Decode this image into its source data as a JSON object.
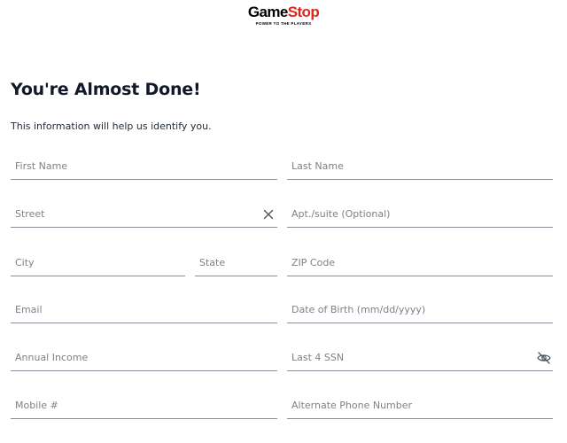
{
  "logo": {
    "brand_part1": "Game",
    "brand_part2": "Stop",
    "tagline": "POWER TO THE PLAYERS",
    "brand_color": "#e1251b"
  },
  "heading": "You're Almost Done!",
  "subtitle": "This information will help us identify you.",
  "fields": {
    "first_name": {
      "placeholder": "First Name",
      "value": ""
    },
    "last_name": {
      "placeholder": "Last Name",
      "value": ""
    },
    "street": {
      "placeholder": "Street",
      "value": "",
      "icon": "close-icon"
    },
    "apt": {
      "placeholder": "Apt./suite (Optional)",
      "value": ""
    },
    "city": {
      "placeholder": "City",
      "value": ""
    },
    "state": {
      "placeholder": "State",
      "value": ""
    },
    "zip": {
      "placeholder": "ZIP Code",
      "value": ""
    },
    "email": {
      "placeholder": "Email",
      "value": ""
    },
    "dob": {
      "placeholder": "Date of Birth (mm/dd/yyyy)",
      "value": ""
    },
    "annual_income": {
      "placeholder": "Annual Income",
      "value": ""
    },
    "ssn": {
      "placeholder": "Last 4 SSN",
      "value": "",
      "icon": "eye-slash-icon"
    },
    "mobile": {
      "placeholder": "Mobile #",
      "value": ""
    },
    "alt_phone": {
      "placeholder": "Alternate Phone Number",
      "value": ""
    }
  }
}
